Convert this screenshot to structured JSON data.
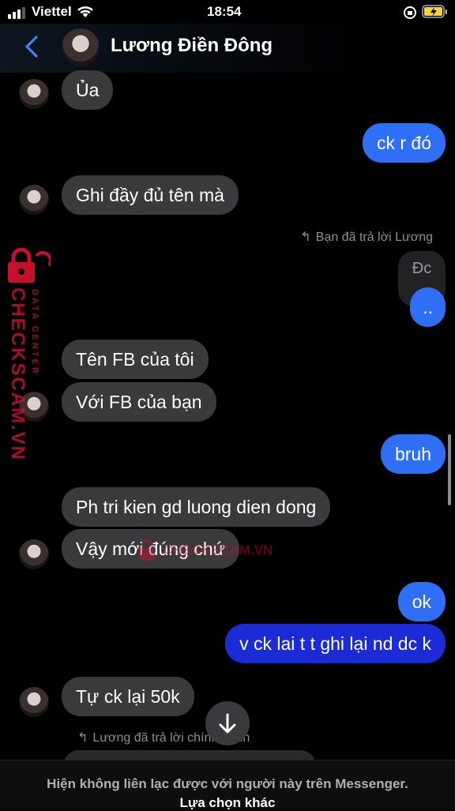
{
  "status_bar": {
    "carrier": "Viettel",
    "time": "18:54"
  },
  "header": {
    "contact_name": "Lương Điền Đông"
  },
  "messages": {
    "m1": "Ủa",
    "m2": "ck r đó",
    "m3": "Ghi đầy đủ tên mà",
    "reply_note_1": "Bạn đã trả lời Lương",
    "quoted": "Đc",
    "m4": "..",
    "m5": "Tên FB của tôi",
    "m6": "Với FB của bạn",
    "m7": "bruh",
    "m8": "Ph tri kien gd luong dien dong",
    "m9": "Vậy mới đúng chứ",
    "m10": "ok",
    "m11": "v ck lai t t ghi lại nd dc k",
    "m12": "Tự ck lại 50k",
    "reply_note_2": "Lương đã trả lời chính mình"
  },
  "footer": {
    "notice": "Hiện không liên lạc được với người này trên Messenger.",
    "action": "Lựa chọn khác"
  },
  "watermark": {
    "brand": "CHECKSCAM.VN",
    "subtitle": "DATA CENTER",
    "inline": "CHECKSCAM.VN"
  },
  "colors": {
    "outgoing": "#2f6ff5",
    "outgoing_dark": "#1b2bd6",
    "incoming": "#3a3a3c",
    "watermark": "#c8102e"
  }
}
